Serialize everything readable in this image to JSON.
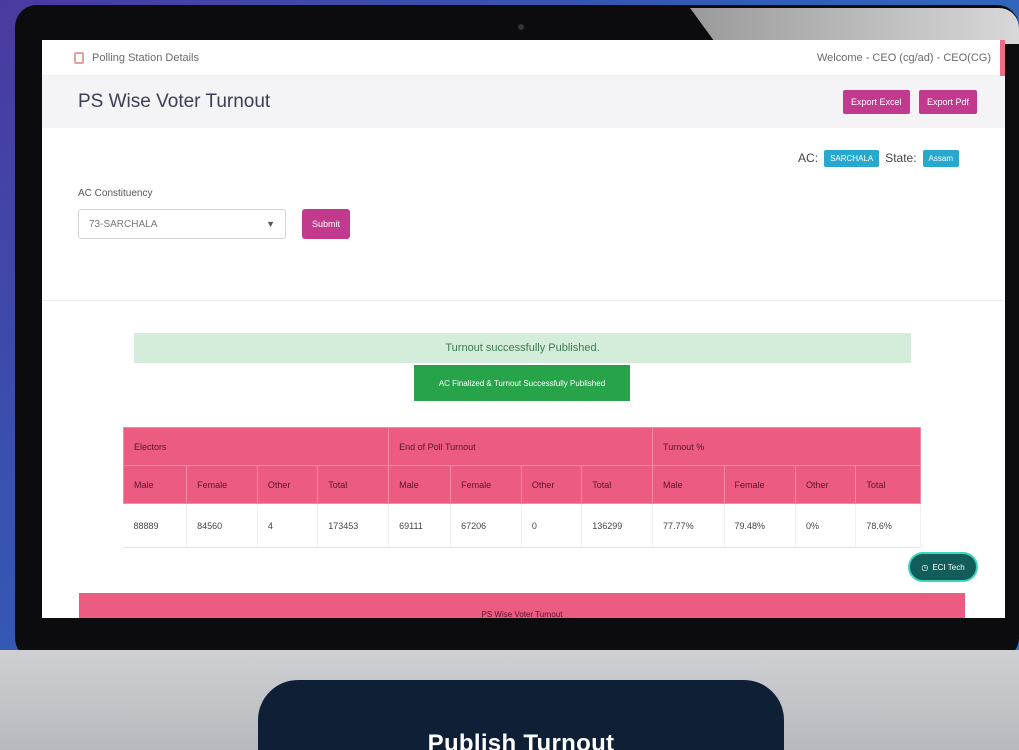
{
  "topbar": {
    "breadcrumb": "Polling Station Details",
    "welcome": "Welcome - CEO (cg/ad) - CEO(CG)"
  },
  "header": {
    "title": "PS Wise Voter Turnout",
    "export_excel": "Export Excel",
    "export_pdf": "Export Pdf"
  },
  "ac_info": {
    "ac_label": "AC:",
    "ac_value": "SARCHALA",
    "state_label": "State:",
    "state_value": "Assam"
  },
  "form": {
    "constituency_label": "AC Constituency",
    "selected_value": "73-SARCHALA",
    "submit_label": "Submit"
  },
  "alert": {
    "message": "Turnout successfully Published."
  },
  "publish_button": {
    "label": "AC Finalized & Turnout Successfully Published"
  },
  "table": {
    "groups": [
      "Electors",
      "End of Poll Turnout",
      "Turnout %"
    ],
    "columns": [
      "Male",
      "Female",
      "Other",
      "Total",
      "Male",
      "Female",
      "Other",
      "Total",
      "Male",
      "Female",
      "Other",
      "Total"
    ],
    "row": [
      "88889",
      "84560",
      "4",
      "173453",
      "69111",
      "67206",
      "0",
      "136299",
      "77.77%",
      "79.48%",
      "0%",
      "78.6%"
    ]
  },
  "chat": {
    "label": "ECI Tech"
  },
  "bottom_banner": {
    "label": "PS Wise Voter Turnout"
  },
  "caption": {
    "text": "Publish Turnout"
  }
}
